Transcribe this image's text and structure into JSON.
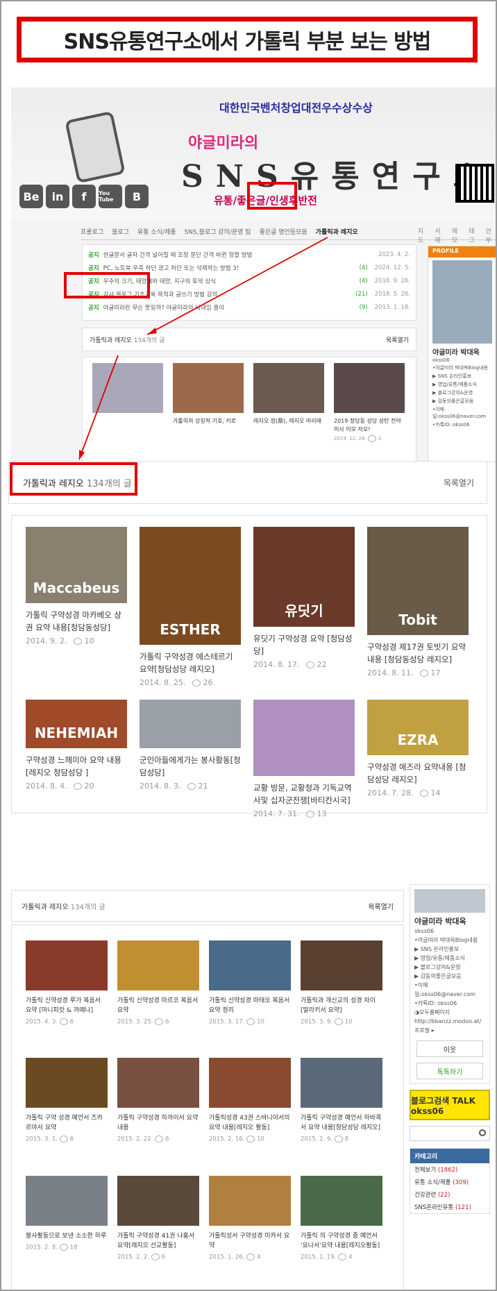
{
  "title": "SNS유통연구소에서 가톨릭 부분 보는 방법",
  "header": {
    "award": "대한민국벤처창업대전우수상수상",
    "brand_small": "야글미라의",
    "brand_big": "SNS유통연구소",
    "slogan": "유통/좋은글/인생후반전",
    "sns_icons": [
      "Be",
      "in",
      "f",
      "You Tube",
      "B"
    ]
  },
  "nav": {
    "items": [
      "프롤로그",
      "블로그",
      "유통 소식/제품",
      "SNS,블로그 강의/운영 팁",
      "좋은글 명언등모음",
      "가톨릭과 레지오"
    ],
    "active_index": 5,
    "right_items": [
      "지도",
      "서재",
      "메모",
      "태그",
      "안부"
    ]
  },
  "notices": [
    {
      "tag": "공지",
      "text": "한글문서 글자 간격 넓어질 때 조정 문단 간격 바뀐 정렬 방법",
      "count": "",
      "date": "2023. 4. 2."
    },
    {
      "tag": "공지",
      "text": "PC, 노트북 우측 하단 광고 차단 또는 삭제하는 방법 3!",
      "count": "(4)",
      "date": "2024. 12. 5."
    },
    {
      "tag": "공지",
      "text": "우주의 크기, 태양계와 태양, 지구의 토막 상식",
      "count": "(4)",
      "date": "2018. 9. 26."
    },
    {
      "tag": "공지",
      "text": "강사 블로그 기초교육 목적과 글쓰기 방법 강의",
      "count": "(21)",
      "date": "2018. 5. 26."
    },
    {
      "tag": "공지",
      "text": "야글미라란 무슨 뜻일까? 야글미라의 닉네임 풀이",
      "count": "(9)",
      "date": "2013. 1. 18."
    }
  ],
  "mini_list": {
    "title": "가톨릭과 레지오",
    "count": "134개의 글",
    "toggle": "목록열기",
    "cards": [
      {
        "title": "",
        "date": ""
      },
      {
        "title": "가톨릭의 상징적 기호, 키로",
        "date": ""
      },
      {
        "title": "레지오 정(鼎), 레지오 마리애",
        "date": ""
      },
      {
        "title": "2019 청담동 성당 성탄 전야 미사 이모 저모!",
        "date": "2019. 12. 26.",
        "comments": "2"
      }
    ]
  },
  "sidebar_top": {
    "section": "PROFILE",
    "name": "야글미라 박대옥",
    "id": "okss06",
    "lines": [
      "•야글미라 박대옥Blog내용",
      "▶ SNS 온라인홍보",
      "▶ 영업/유통/제품소식",
      "▶ 블로그강의&운영",
      "▶ 감동의좋은글모음",
      "•이메일:okss06@naver.com",
      "•카톡ID: okss06"
    ]
  },
  "big_list": {
    "title": "가톨릭과 레지오",
    "count": "134개의 글",
    "toggle": "목록열기",
    "cards": [
      {
        "title": "가톨릭 구약성경 마카베오 상권 요약 내용[청담동성당]",
        "date": "2014. 9. 2.",
        "comments": "10",
        "thumb_label": "Maccabeus",
        "thumb_h": 110,
        "color": "#8a8070"
      },
      {
        "title": "가톨릭 구약성경 에스테르기 요약[청담성당 레지오]",
        "date": "2014. 8. 25.",
        "comments": "26",
        "thumb_label": "ESTHER",
        "thumb_h": 170,
        "color": "#7a4a20"
      },
      {
        "title": "유딧기 구약성경 요약 [청담성당]",
        "date": "2014. 8. 17.",
        "comments": "22",
        "thumb_label": "유딧기",
        "thumb_h": 144,
        "color": "#6a3a2a"
      },
      {
        "title": "구약성경 제17권 토빗기 요약 내용 [청담동성당 레지오]",
        "date": "2014. 8. 11.",
        "comments": "17",
        "thumb_label": "Tobit",
        "thumb_h": 156,
        "color": "#6a5a48"
      },
      {
        "title": "구약성경 느헤미아 요약 내용 [레지오 청담성당 ]",
        "date": "2014. 8. 4.",
        "comments": "20",
        "thumb_label": "NEHEMIAH",
        "thumb_h": 70,
        "color": "#a04a2a"
      },
      {
        "title": "군인아들에게가는 봉사활동[청담성당]",
        "date": "2014. 8. 3.",
        "comments": "21",
        "thumb_label": "",
        "thumb_h": 70,
        "color": "#9aa0a8"
      },
      {
        "title": "교황 방문, 교황청과 기독교역사및 십자군전쟁[바티칸시국]",
        "date": "2014. 7. 31.",
        "comments": "13",
        "thumb_label": "",
        "thumb_h": 110,
        "color": "#b090c0"
      },
      {
        "title": "구약성경 에즈라 요약내용 [청담성당 레지오]",
        "date": "2014. 7. 28.",
        "comments": "14",
        "thumb_label": "EZRA",
        "thumb_h": 80,
        "color": "#c0a040"
      }
    ]
  },
  "low_list": {
    "title": "가톨릭과 레지오",
    "count": "134개의 글",
    "toggle": "목록열기",
    "cards": [
      {
        "title": "가톨릭 신약성경 루가 복음서 요약 [마니피캇 & 까떼나]",
        "date": "2015. 4. 3.",
        "comments": "6",
        "color": "#8a3a2a"
      },
      {
        "title": "가톨릭 신약성경 마르코 복음서 요약",
        "date": "2015. 3. 25.",
        "comments": "6",
        "color": "#c09030"
      },
      {
        "title": "가톨릭 신약성경 마태오 복음서 요약 정리",
        "date": "2015. 3. 17.",
        "comments": "10",
        "color": "#4a6a8a"
      },
      {
        "title": "가톨릭과 개신교의 성경 차이 [말라키서 요약]",
        "date": "2015. 3. 9.",
        "comments": "10",
        "color": "#5a4030"
      },
      {
        "title": "가톨릭 구약 성경 예언서 즈카르야서 요약",
        "date": "2015. 3. 1.",
        "comments": "6",
        "color": "#6a4a20"
      },
      {
        "title": "가톨릭 구약성경 하까이서 요약 내용",
        "date": "2015. 2. 22.",
        "comments": "6",
        "color": "#7a5040"
      },
      {
        "title": "가톨릭성경 43권 스바니야서의 요약 내용[레지오 활동]",
        "date": "2015. 2. 16.",
        "comments": "10",
        "color": "#8a4a30"
      },
      {
        "title": "가톨릭 구약성경 예언서 하바쿡서 요약 내용[청담성당 레지오]",
        "date": "2015. 2. 9.",
        "comments": "8",
        "color": "#5a6a7a"
      },
      {
        "title": "봉사활동으로 보낸 소소한 하루",
        "date": "2015. 2. 8.",
        "comments": "18",
        "color": "#7a8088"
      },
      {
        "title": "가톨릭 구약성경 41권 나훔서 요약[레지오 선교활동]",
        "date": "2015. 2. 2.",
        "comments": "6",
        "color": "#5a4a3a"
      },
      {
        "title": "가톨릭성서 구약성경 미카서 요약",
        "date": "2015. 1. 26.",
        "comments": "4",
        "color": "#b08040"
      },
      {
        "title": "가톨릭 의 구약성경 중 예언서 '요나서'요약 내용[레지오활동]",
        "date": "2015. 1. 19.",
        "comments": "4",
        "color": "#4a6a4a"
      }
    ]
  },
  "sidebar_bottom": {
    "name": "야글미라 박대옥",
    "id": "okss06",
    "lines": [
      "•야글미라 박대옥Blog내용",
      "▶ SNS 온라인홍보",
      "▶ 영업/유통/제품소식",
      "▶ 블로그강의&운영",
      "▶ 감동의좋은글모음",
      "•이메일:okss06@naver.com",
      "•카톡ID: okss06",
      "◑모두홈페이지",
      "http://bbanzz.modoo.at/",
      "프로필 ▸"
    ],
    "neighbor_btn": "이웃",
    "chat_btn": "톡톡하기",
    "talk_banner": "블로그검색 TALK okss06",
    "category_title": "카테고리",
    "categories": [
      {
        "name": "전체보기",
        "count": "(1862)"
      },
      {
        "name": "유통 소식/제품",
        "count": "(309)"
      },
      {
        "name": "건강관련",
        "count": "(22)"
      },
      {
        "name": "SNS온라인유통",
        "count": "(121)"
      }
    ]
  },
  "colors": {
    "red_box": "#e00000",
    "accent_green": "#28a028",
    "profile_orange": "#f08010"
  }
}
